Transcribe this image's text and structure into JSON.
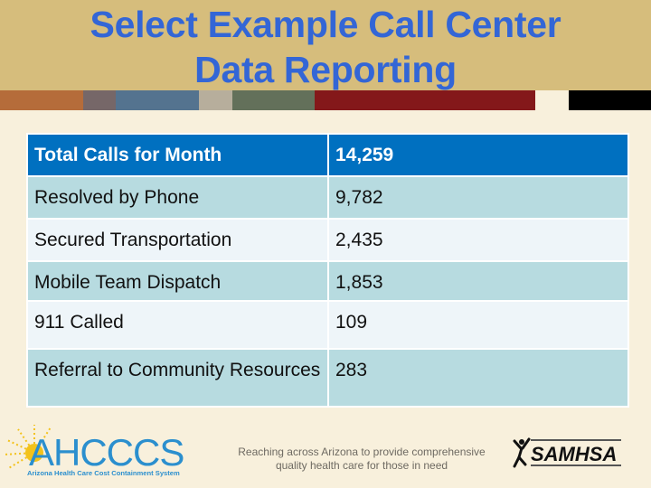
{
  "slide": {
    "title_line1": "Select Example Call Center",
    "title_line2": "Data Reporting",
    "colors": {
      "banner": "#d6bd7c",
      "title": "#3366d6",
      "header_row": "#0070c0",
      "row_odd": "#b7dbe0",
      "row_even": "#eef5f9",
      "background": "#f8f0dc"
    },
    "color_bar": [
      "#b56c3a",
      "#766768",
      "#54738f",
      "#b7ae9c",
      "#63705a",
      "#84181a",
      "#f8f0dc",
      "#000000"
    ]
  },
  "table": {
    "rows": [
      {
        "label": "Total Calls for Month",
        "value": "14,259"
      },
      {
        "label": "Resolved by Phone",
        "value": "9,782"
      },
      {
        "label": "Secured Transportation",
        "value": "2,435"
      },
      {
        "label": "Mobile Team Dispatch",
        "value": "1,853"
      },
      {
        "label": "911 Called",
        "value": "109"
      },
      {
        "label": "Referral to Community Resources",
        "value": "283"
      }
    ]
  },
  "footer": {
    "tagline_line1": "Reaching across Arizona to provide comprehensive",
    "tagline_line2": "quality health care for those in need",
    "ahcccs_logo": {
      "name": "AHCCCS",
      "subtitle": "Arizona Health Care Cost Containment System",
      "icon": "sun-icon"
    },
    "samhsa_logo": {
      "name": "SAMHSA",
      "icon": "person-figure-icon"
    }
  }
}
